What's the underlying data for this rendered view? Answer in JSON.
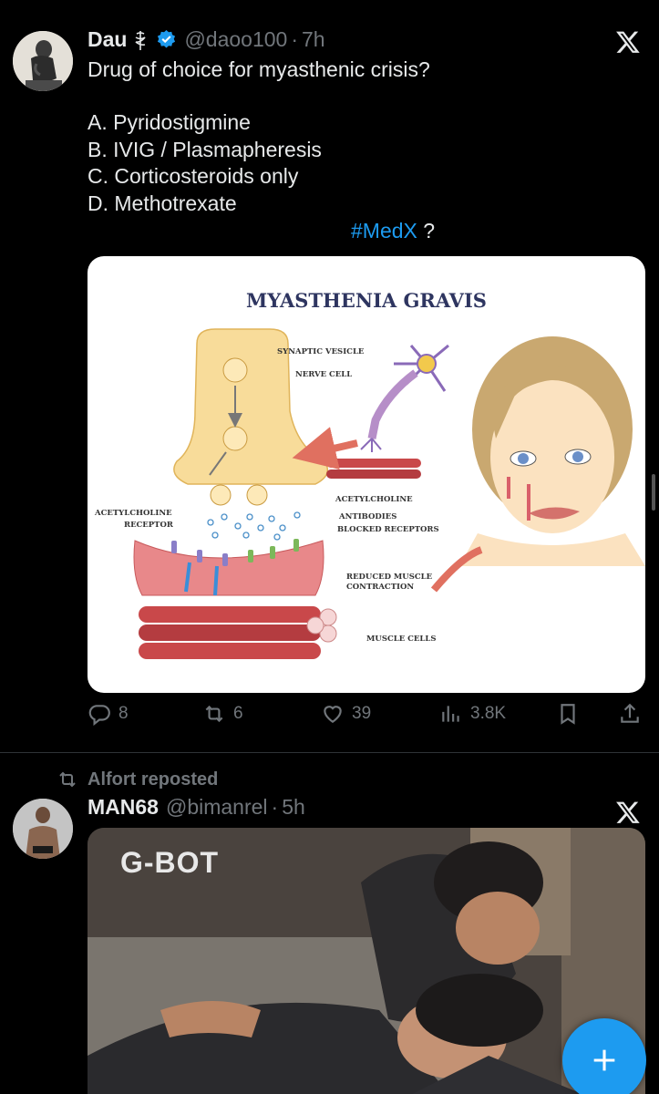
{
  "tweet1": {
    "name": "Dau",
    "handle": "@daoo100",
    "dot": "·",
    "time": "7h",
    "question": "Drug of choice for myasthenic crisis?",
    "options": [
      "A. Pyridostigmine",
      "B. IVIG / Plasmapheresis",
      "C. Corticosteroids only",
      "D. Methotrexate"
    ],
    "hashtag": "#MedX",
    "hashtag_suffix": " ?",
    "image": {
      "title": "MYASTHENIA GRAVIS",
      "labels": {
        "synaptic_vesicle": "SYNAPTIC VESICLE",
        "nerve_cell": "NERVE CELL",
        "acetylcholine": "ACETYLCHOLINE",
        "antibodies": "ANTIBODIES",
        "blocked_receptors": "BLOCKED RECEPTORS",
        "ach_receptor_1": "ACETYLCHOLINE",
        "ach_receptor_2": "RECEPTOR",
        "reduced_1": "REDUCED MUSCLE",
        "reduced_2": "CONTRACTION",
        "muscle_cells": "MUSCLE CELLS"
      }
    },
    "stats": {
      "replies": "8",
      "reposts": "6",
      "likes": "39",
      "views": "3.8K"
    }
  },
  "repost_label": "Alfort reposted",
  "tweet2": {
    "name": "MAN68",
    "handle": "@bimanrel",
    "dot": "·",
    "time": "5h",
    "watermark": "G-BOT"
  },
  "colors": {
    "accent": "#1d9bf0",
    "muted": "#71767b",
    "text": "#e7e9ea",
    "background": "#000000"
  }
}
